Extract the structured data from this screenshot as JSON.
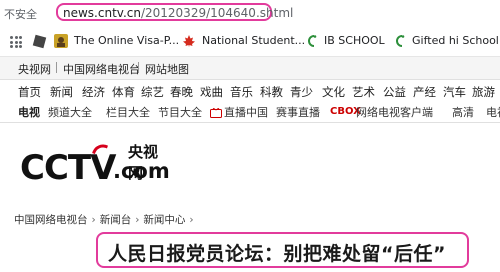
{
  "browser": {
    "security_label": "不安全",
    "url": "news.cntv.cn",
    "url_path": "/20120329/104640.shtml"
  },
  "bookmarks": [
    {
      "label": "The Online Visa-P...",
      "icon": "portrait-icon"
    },
    {
      "label": "National Student...",
      "icon": "maple-leaf-icon"
    },
    {
      "label": "IB SCHOOL",
      "icon": "ib-icon"
    },
    {
      "label": "Gifted hi School",
      "icon": "ib-icon"
    }
  ],
  "site_nav": {
    "items": [
      "央视网",
      "中国网络电视台",
      "网站地图"
    ]
  },
  "menu_primary": [
    "首页",
    "新闻",
    "经济",
    "体育",
    "综艺",
    "春晚",
    "戏曲",
    "音乐",
    "科教",
    "青少",
    "文化",
    "艺术",
    "公益",
    "产经",
    "汽车",
    "旅游"
  ],
  "menu_secondary": {
    "lead": "电视",
    "items": [
      "频道大全",
      "栏目大全",
      "节目大全",
      "直播中国",
      "赛事直播",
      "网络电视客户端",
      "高清",
      "电视"
    ],
    "cbox_label": "CBOX"
  },
  "logo": {
    "brand": "CCTV",
    "suffix": ".com",
    "cn_name": "央视网"
  },
  "breadcrumb": [
    "中国网络电视台",
    "新闻台",
    "新闻中心"
  ],
  "article": {
    "title": "人民日报党员论坛：别把难处留“后任”"
  },
  "colors": {
    "highlight": "#e23b9c",
    "brand_red": "#d6001c"
  }
}
